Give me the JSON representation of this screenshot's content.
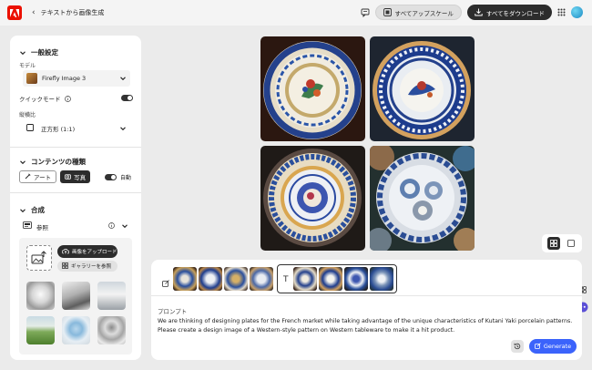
{
  "header": {
    "back_label": "テキストから画像生成",
    "upscale_all_label": "すべてアップスケール",
    "download_all_label": "すべてをダウンロード"
  },
  "panel": {
    "general": {
      "title": "一般設定",
      "model_label": "モデル",
      "model_value": "Firefly Image 3",
      "quick_mode_label": "クイックモード",
      "quick_mode_on": true,
      "aspect_label": "縦横比",
      "aspect_value": "正方形 (1:1)"
    },
    "content_type": {
      "title": "コンテンツの種類",
      "art_label": "アート",
      "photo_label": "写真",
      "auto_label": "自動",
      "auto_on": true
    },
    "composition": {
      "title": "合成",
      "reference_label": "参照",
      "upload_label": "画像をアップロード",
      "gallery_label": "ギャラリーを参照"
    }
  },
  "prompt": {
    "label": "プロンプト",
    "text": "We are thinking of designing plates for the French market while taking advantage of the unique characteristics of Kutani Yaki porcelain patterns. Please create a design image of a Western-style pattern on Western tableware to make it a hit product.",
    "generate_label": "Generate"
  },
  "colors": {
    "accent": "#3b63fb",
    "brand": "#eb1000",
    "dark": "#2c2c2c",
    "porcelain_blue": "#1f3f8f"
  }
}
